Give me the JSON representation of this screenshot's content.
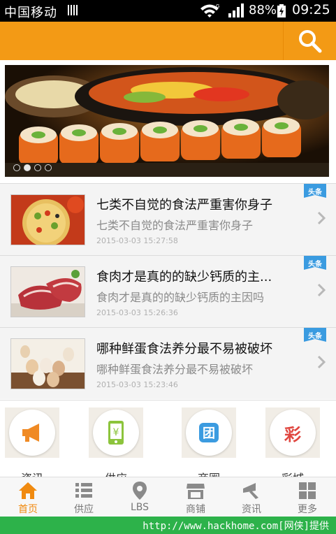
{
  "status_bar": {
    "carrier": "中国移动",
    "battery": "88%",
    "time": "09:25"
  },
  "header": {
    "search_icon": "search-icon"
  },
  "banner": {
    "dot_count": 4,
    "active_dot": 1
  },
  "news": [
    {
      "title": "七类不自觉的食法严重害你身子",
      "summary": "七类不自觉的食法严重害你身子",
      "date": "2015-03-03 15:27:58",
      "badge": "头条"
    },
    {
      "title": "食肉才是真的的缺少钙质的主...",
      "summary": "食肉才是真的的缺少钙质的主因吗",
      "date": "2015-03-03 15:26:36",
      "badge": "头条"
    },
    {
      "title": "哪种鲜蛋食法养分最不易被破坏",
      "summary": "哪种鲜蛋食法养分最不易被破坏",
      "date": "2015-03-03 15:23:46",
      "badge": "头条"
    }
  ],
  "categories": [
    {
      "icon": "megaphone-icon",
      "label": "资讯",
      "color": "#f08a24"
    },
    {
      "icon": "phone-yen-icon",
      "label": "供应",
      "color": "#8cc43c"
    },
    {
      "icon": "group-buy-icon",
      "label": "商圈",
      "glyph": "团",
      "color": "#3b9be0"
    },
    {
      "icon": "lottery-icon",
      "label": "彩城",
      "glyph": "彩",
      "color": "#e0463f"
    }
  ],
  "tabs": [
    {
      "icon": "home-icon",
      "label": "首页",
      "active": true
    },
    {
      "icon": "list-icon",
      "label": "供应",
      "active": false
    },
    {
      "icon": "location-pin-icon",
      "label": "LBS",
      "active": false
    },
    {
      "icon": "shop-icon",
      "label": "商铺",
      "active": false
    },
    {
      "icon": "megaphone-icon",
      "label": "资讯",
      "active": false
    },
    {
      "icon": "grid-icon",
      "label": "更多",
      "active": false
    }
  ],
  "watermark": "http://www.hackhome.com[网侠]提供",
  "colors": {
    "accent": "#f39a15",
    "badge": "#3a9be0",
    "tab_active": "#f08a10",
    "watermark_bg": "#2db24a"
  }
}
